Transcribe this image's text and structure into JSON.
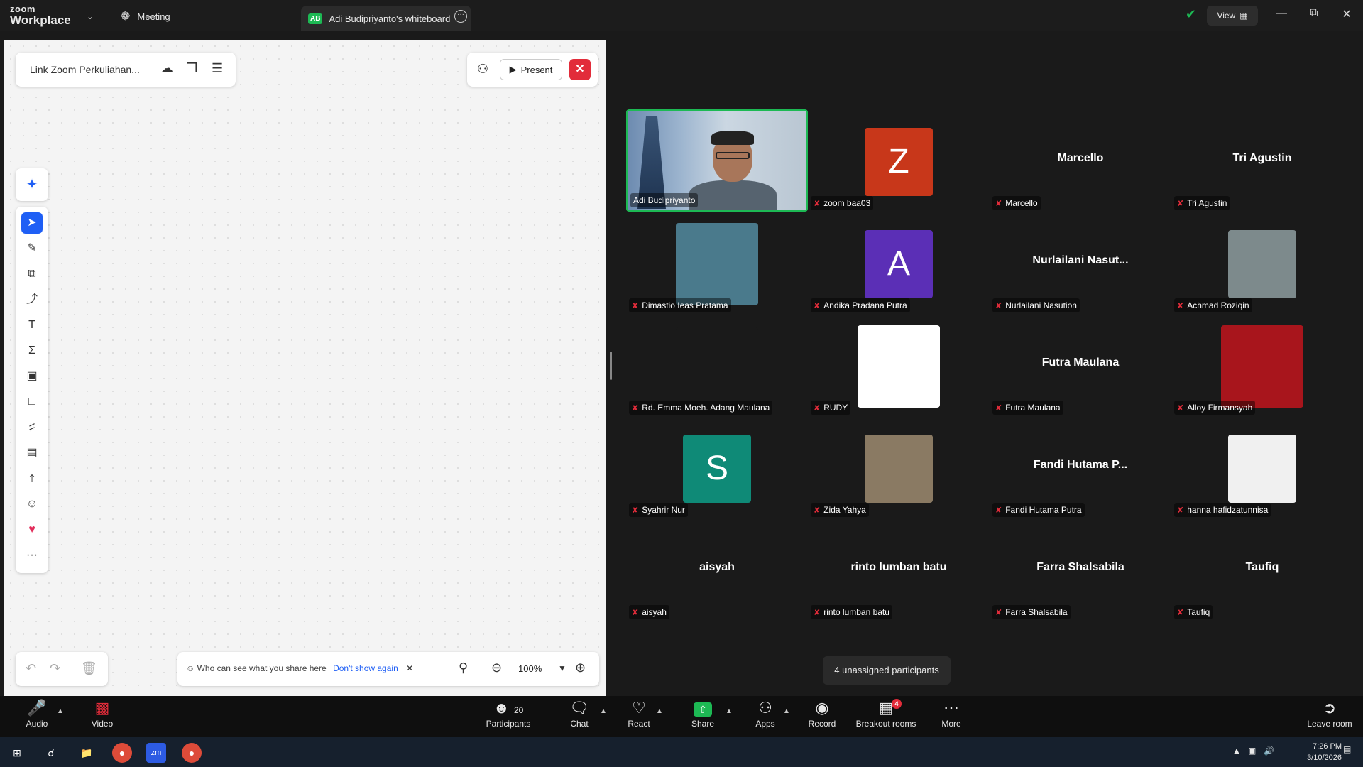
{
  "titlebar": {
    "logo_line1": "zoom",
    "logo_line2": "Workplace",
    "meeting_tab": "Meeting",
    "wb_badge": "AB",
    "wb_tab": "Adi Budipriyanto's whiteboard",
    "view_label": "View"
  },
  "whiteboard": {
    "doc_title": "Link Zoom Perkuliahan...",
    "present_label": "Present",
    "share_note": "Who can see what you share here",
    "dont_show": "Don't show again",
    "zoom_level": "100%"
  },
  "gallery": {
    "tiles": [
      {
        "name": "Adi Budipriyanto",
        "kind": "video"
      },
      {
        "name": "zoom baa03",
        "kind": "letter",
        "letter": "Z",
        "color": "#c8371a"
      },
      {
        "name": "Marcello",
        "kind": "name",
        "big": "Marcello"
      },
      {
        "name": "Tri Agustin",
        "kind": "name",
        "big": "Tri Agustin"
      },
      {
        "name": "Dimastio Ieas Pratama",
        "kind": "photo",
        "color": "#4a7a8c",
        "w": 116,
        "h": 116
      },
      {
        "name": "Andika Pradana Putra",
        "kind": "letter",
        "letter": "A",
        "color": "#5b2fb6"
      },
      {
        "name": "Nurlailani Nasution",
        "kind": "name",
        "big": "Nurlailani  Nasut..."
      },
      {
        "name": "Achmad Roziqin",
        "kind": "photo",
        "color": "#7d8a8c",
        "w": 96,
        "h": 96
      },
      {
        "name": "Rd. Emma Moeh. Adang Maulana",
        "kind": "photo",
        "color": "#1a1a1a",
        "w": 116,
        "h": 110
      },
      {
        "name": "RUDY",
        "kind": "photo",
        "color": "#ffffff",
        "w": 116,
        "h": 116
      },
      {
        "name": "Futra Maulana",
        "kind": "name",
        "big": "Futra Maulana"
      },
      {
        "name": "Alloy Firmansyah",
        "kind": "photo",
        "color": "#a8151c",
        "w": 116,
        "h": 116
      },
      {
        "name": "Syahrir Nur",
        "kind": "letter",
        "letter": "S",
        "color": "#0f8a77"
      },
      {
        "name": "Zida Yahya",
        "kind": "photo",
        "color": "#8a7a63",
        "w": 96,
        "h": 96
      },
      {
        "name": "Fandi Hutama Putra",
        "kind": "name",
        "big": "Fandi  Hutama  P..."
      },
      {
        "name": "hanna hafidzatunnisa",
        "kind": "photo",
        "color": "#f0f0f0",
        "w": 96,
        "h": 96
      },
      {
        "name": "aisyah",
        "kind": "name",
        "big": "aisyah"
      },
      {
        "name": "rinto lumban batu",
        "kind": "name",
        "big": "rinto lumban batu"
      },
      {
        "name": "Farra Shalsabila",
        "kind": "name",
        "big": "Farra Shalsabila"
      },
      {
        "name": "Taufiq",
        "kind": "name",
        "big": "Taufiq"
      }
    ],
    "unassigned": "4 unassigned participants"
  },
  "toolbar": {
    "audio": "Audio",
    "video": "Video",
    "participants": "Participants",
    "participants_count": "20",
    "chat": "Chat",
    "react": "React",
    "share": "Share",
    "apps": "Apps",
    "record": "Record",
    "breakout": "Breakout rooms",
    "breakout_badge": "4",
    "more": "More",
    "leave": "Leave room"
  },
  "taskbar": {
    "time": "7:26 PM",
    "date": "3/10/2026",
    "notif": "1"
  },
  "colors": {
    "accent": "#1f5ff5",
    "active_speaker": "#1db954",
    "danger": "#e22c3a"
  }
}
